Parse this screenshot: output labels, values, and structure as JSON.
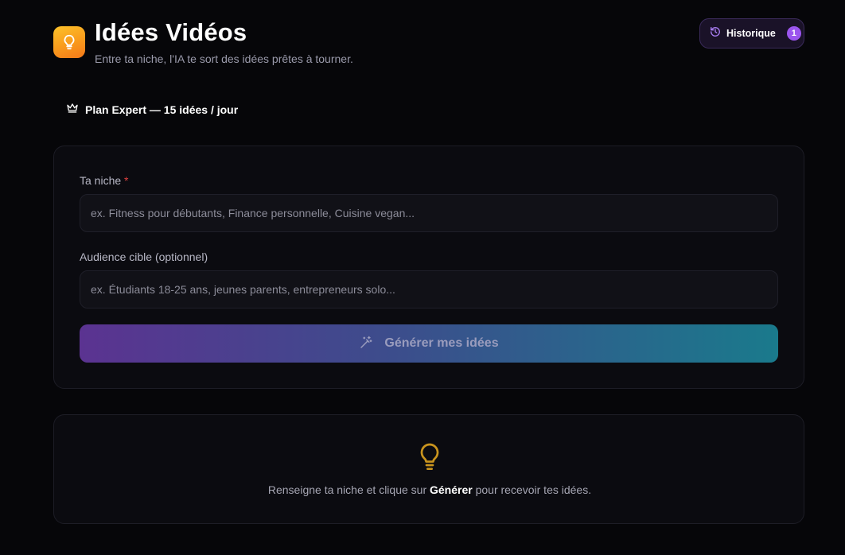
{
  "header": {
    "title": "Idées Vidéos",
    "subtitle": "Entre ta niche, l'IA te sort des idées prêtes à tourner.",
    "app_icon": "lightbulb-icon",
    "history_button": {
      "label": "Historique",
      "icon": "history-icon",
      "count": "1"
    }
  },
  "plan": {
    "icon": "crown-icon",
    "label": "Plan Expert — 15 idées / jour"
  },
  "form": {
    "niche": {
      "label": "Ta niche",
      "required_mark": "*",
      "placeholder": "ex. Fitness pour débutants, Finance personnelle, Cuisine vegan...",
      "value": ""
    },
    "audience": {
      "label": "Audience cible (optionnel)",
      "placeholder": "ex. Étudiants 18-25 ans, jeunes parents, entrepreneurs solo...",
      "value": ""
    },
    "generate_button": {
      "label": "Générer mes idées",
      "icon": "magic-wand-icon"
    }
  },
  "empty_state": {
    "icon": "lightbulb-icon",
    "text_before": "Renseigne ta niche et clique sur ",
    "text_bold": "Générer",
    "text_after": " pour recevoir tes idées."
  },
  "colors": {
    "background": "#060609",
    "accent_purple": "#9b55ee",
    "accent_orange": "#f99a1c",
    "required_red": "#e0413f",
    "bulb_gold": "#c9941e"
  }
}
